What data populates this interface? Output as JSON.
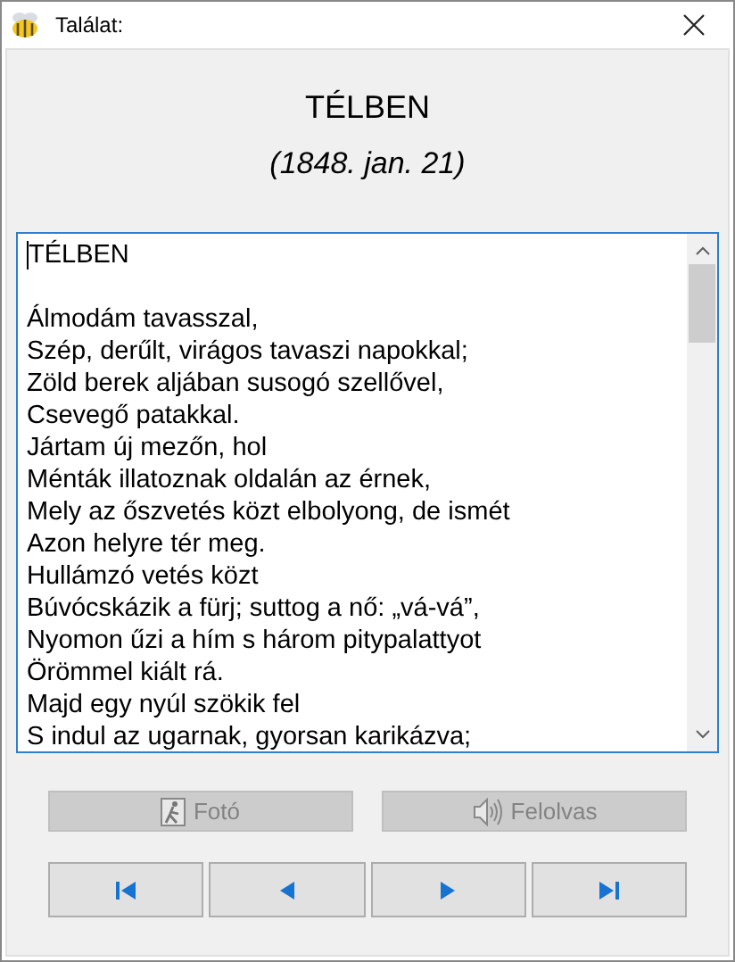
{
  "window": {
    "title": "Találat:"
  },
  "heading": {
    "title": "TÉLBEN",
    "date": "(1848. jan. 21)"
  },
  "text": {
    "stanzas": [
      [
        "TÉLBEN"
      ],
      [
        "Álmodám tavasszal,",
        "Szép, derűlt, virágos tavaszi napokkal;",
        "Zöld berek aljában susogó szellővel,",
        "Csevegő patakkal.",
        "Jártam új mezőn, hol",
        "Ménták illatoznak oldalán az érnek,",
        "Mely az őszvetés közt elbolyong, de ismét",
        "Azon helyre tér meg.",
        "Hullámzó vetés közt",
        "Búvócskázik a fürj; suttog a nő: „vá-vá”,",
        "Nyomon űzi a hím s három pitypalattyot",
        "Örömmel kiált rá.",
        "Majd egy nyúl szökik fel",
        "S indul az ugarnak, gyorsan karikázva;"
      ]
    ]
  },
  "actions": [
    {
      "kind": "photo",
      "label": "Fotó",
      "disabled": true
    },
    {
      "kind": "speaker",
      "label": "Felolvas",
      "disabled": true
    }
  ],
  "navigation": [
    {
      "kind": "first"
    },
    {
      "kind": "previous"
    },
    {
      "kind": "next"
    },
    {
      "kind": "last"
    }
  ]
}
